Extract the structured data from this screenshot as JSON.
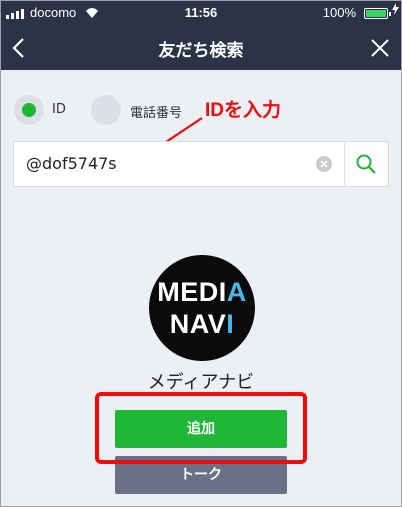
{
  "status_bar": {
    "carrier": "docomo",
    "time": "11:56",
    "battery_percent": "100%",
    "battery_level": 1.0,
    "signal_icon": "signal-bars-icon",
    "wifi_icon": "wifi-icon"
  },
  "nav": {
    "title": "友だち検索",
    "back_icon": "chevron-left-icon",
    "close_icon": "close-icon"
  },
  "search_type": {
    "options": [
      {
        "label": "ID",
        "selected": true
      },
      {
        "label": "電話番号",
        "selected": false
      }
    ],
    "selected_color": "#20b636"
  },
  "annotation": {
    "text": "IDを入力",
    "color": "#ee0c0c"
  },
  "search": {
    "value": "@dof5747s",
    "clear_icon": "clear-icon",
    "search_icon": "search-icon"
  },
  "profile": {
    "avatar_line1_pre": "MEDI",
    "avatar_line1_accent": "A",
    "avatar_line2_pre": "NAV",
    "avatar_line2_accent": "I",
    "name": "メディアナビ"
  },
  "buttons": {
    "add_label": "追加",
    "talk_label": "トーク",
    "add_color": "#20b636",
    "talk_color": "#6a7187"
  }
}
